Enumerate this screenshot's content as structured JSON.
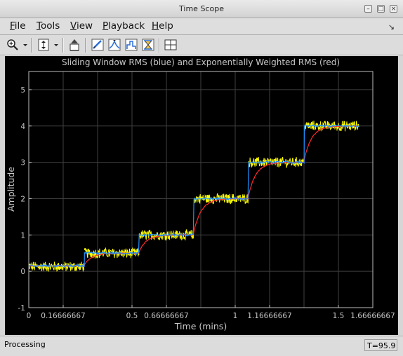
{
  "window": {
    "title": "Time Scope"
  },
  "menu": {
    "items": [
      {
        "label": "File",
        "mnemonic": "F",
        "rest": "ile"
      },
      {
        "label": "Tools",
        "mnemonic": "T",
        "rest": "ools"
      },
      {
        "label": "View",
        "mnemonic": "V",
        "rest": "iew"
      },
      {
        "label": "Playback",
        "mnemonic": "P",
        "rest": "layback"
      },
      {
        "label": "Help",
        "mnemonic": "H",
        "rest": "elp"
      }
    ]
  },
  "toolbar": {
    "buttons": [
      "zoom-in-icon",
      "dropdown-arrow-icon",
      "scale-axes-icon",
      "dropdown-arrow-icon",
      "restore-view-icon",
      "data-cursor-icon",
      "peak-finder-icon",
      "signal-statistics-icon",
      "bilevel-measurements-icon",
      "layout-icon"
    ]
  },
  "chart_data": {
    "type": "line",
    "title": "Sliding Window RMS (blue) and Exponentially Weighted RMS (red)",
    "xlabel": "Time (mins)",
    "ylabel": "Amplitude",
    "xlim": [
      0,
      1.6666667
    ],
    "ylim": [
      -1,
      5.5
    ],
    "x_ticks": [
      0,
      0.16666667,
      0.5,
      0.66666667,
      1,
      1.16666667,
      1.5,
      1.66666667
    ],
    "x_tick_labels": [
      "0",
      "0.16666667",
      "0.5",
      "0.66666667",
      "1",
      "1.16666667",
      "1.5",
      "1.66666667"
    ],
    "y_ticks": [
      -1,
      0,
      1,
      2,
      3,
      4,
      5
    ],
    "y_tick_labels": [
      "-1",
      "0",
      "1",
      "2",
      "3",
      "4",
      "5"
    ],
    "grid": true,
    "background": "#000000",
    "series": [
      {
        "color": "#ffff00",
        "segments": [
          {
            "x_start": 0,
            "x_end": 0.27,
            "level": 0.13,
            "noise": 0.13
          },
          {
            "x_start": 0.27,
            "x_end": 0.535,
            "level": 0.5,
            "noise": 0.13
          },
          {
            "x_start": 0.535,
            "x_end": 0.8,
            "level": 1.0,
            "noise": 0.13
          },
          {
            "x_start": 0.8,
            "x_end": 1.065,
            "level": 2.0,
            "noise": 0.13
          },
          {
            "x_start": 1.065,
            "x_end": 1.335,
            "level": 3.0,
            "noise": 0.13
          },
          {
            "x_start": 1.335,
            "x_end": 1.6,
            "level": 4.0,
            "noise": 0.13
          }
        ]
      },
      {
        "color": "#1e90ff",
        "segments": [
          {
            "x_start": 0,
            "x_end": 0.27,
            "level": 0.15
          },
          {
            "x_start": 0.27,
            "x_end": 0.535,
            "level": 0.5
          },
          {
            "x_start": 0.535,
            "x_end": 0.8,
            "level": 1.0
          },
          {
            "x_start": 0.8,
            "x_end": 1.065,
            "level": 2.0
          },
          {
            "x_start": 1.065,
            "x_end": 1.335,
            "level": 3.0
          },
          {
            "x_start": 1.335,
            "x_end": 1.6,
            "level": 4.0
          }
        ]
      },
      {
        "color": "#ff2a2a",
        "smoothing": "exponential",
        "x_end": 1.6,
        "targets": [
          0.15,
          0.5,
          1.0,
          2.0,
          3.0,
          4.0
        ]
      }
    ]
  },
  "status": {
    "left": "Processing",
    "right": "T=95.9"
  }
}
